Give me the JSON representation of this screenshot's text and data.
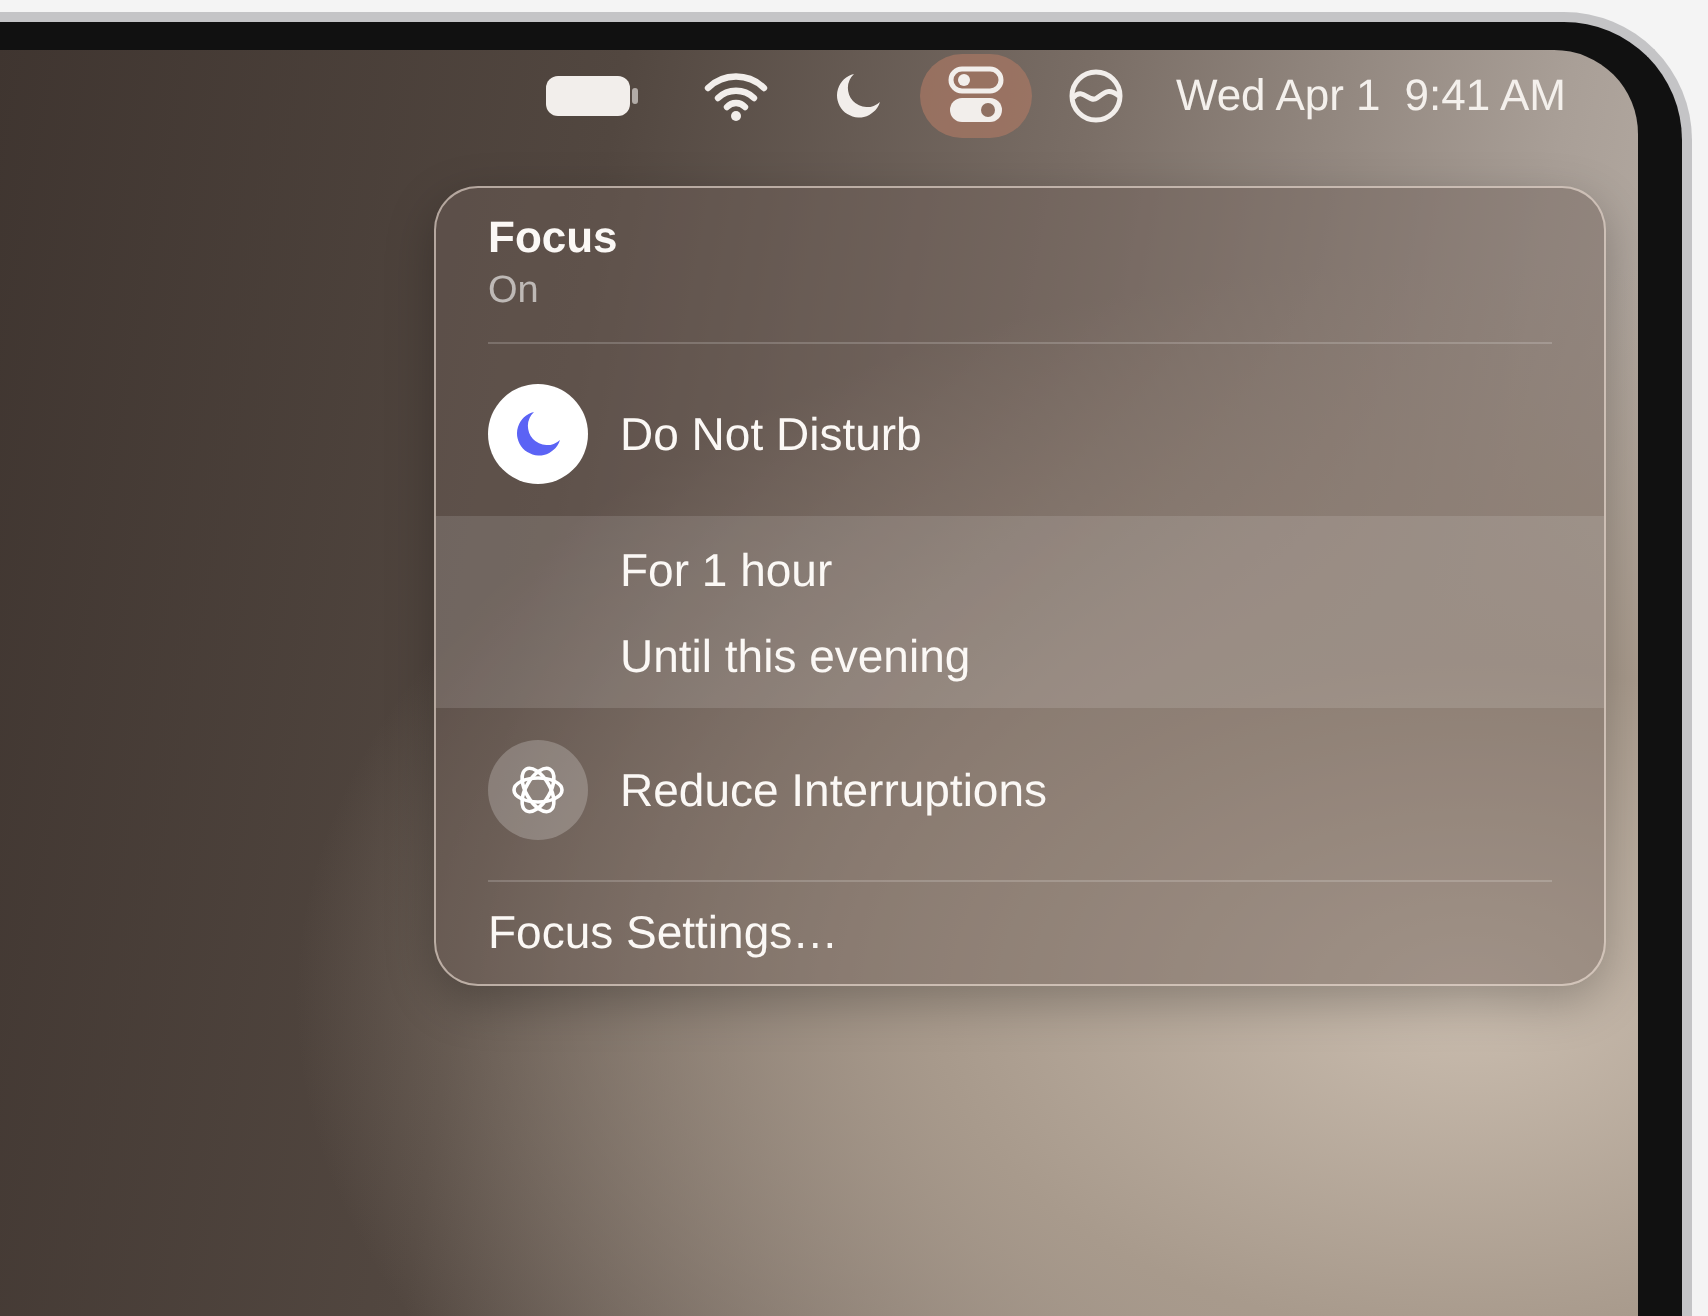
{
  "menu_bar": {
    "icons": [
      {
        "kind": "battery",
        "selected": false
      },
      {
        "kind": "wifi",
        "selected": false
      },
      {
        "kind": "moon",
        "selected": false
      },
      {
        "kind": "toggles",
        "selected": true
      },
      {
        "kind": "wave",
        "selected": false
      }
    ],
    "date": "Wed Apr 1",
    "time": "9:41 AM"
  },
  "focus_panel": {
    "title": "Focus",
    "status": "On",
    "modes": [
      {
        "label": "Do Not Disturb",
        "kind": "moon",
        "on": true,
        "expanded": true,
        "options": [
          "For 1 hour",
          "Until this evening"
        ]
      },
      {
        "label": "Reduce Interruptions",
        "kind": "atom",
        "on": false,
        "expanded": false
      }
    ],
    "settings_link": "Focus Settings…"
  }
}
